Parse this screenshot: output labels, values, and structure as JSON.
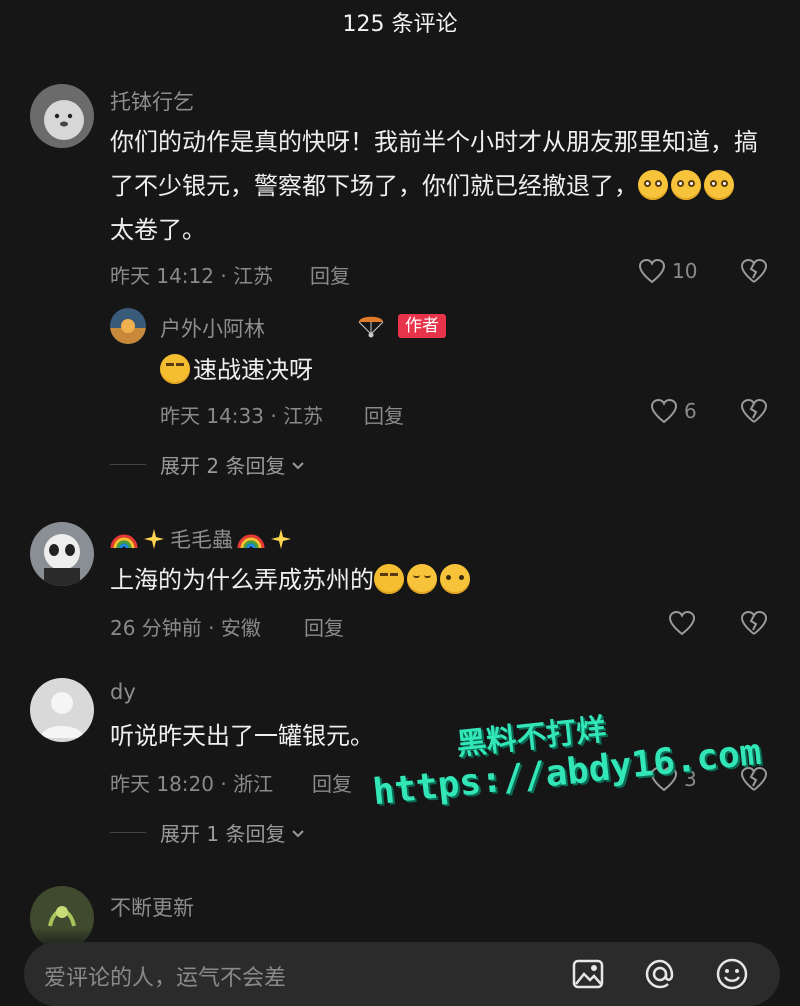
{
  "header": {
    "title": "125 条评论"
  },
  "comments": [
    {
      "user": "托钵行乞",
      "text": "你们的动作是真的快呀！我前半个小时才从朋友那里知道，搞了不少银元，警察都下场了，你们就已经撤退了，",
      "text_tail": "太卷了。",
      "meta": "昨天 14:12 · 江苏",
      "reply": "回复",
      "likes": "10",
      "replies": [
        {
          "user": "户外小阿林",
          "badge": "作者",
          "text": "速战速决呀",
          "meta": "昨天 14:33 · 江苏",
          "reply": "回复",
          "likes": "6"
        }
      ],
      "expand": "展开 2 条回复"
    },
    {
      "user": "毛毛蟲",
      "text": "上海的为什么弄成苏州的",
      "meta": "26 分钟前 · 安徽",
      "reply": "回复",
      "likes": ""
    },
    {
      "user": "dy",
      "text": "听说昨天出了一罐银元。",
      "meta": "昨天 18:20 · 浙江",
      "reply": "回复",
      "likes": "3",
      "expand": "展开 1 条回复"
    },
    {
      "user": "不断更新"
    }
  ],
  "watermark": {
    "line1": "黑料不打烊",
    "line2": "https://abdy16.com"
  },
  "input": {
    "placeholder": "爱评论的人，运气不会差"
  },
  "colors": {
    "background": "#161616",
    "badge": "#e8344b",
    "watermark": "#32e6b8"
  }
}
